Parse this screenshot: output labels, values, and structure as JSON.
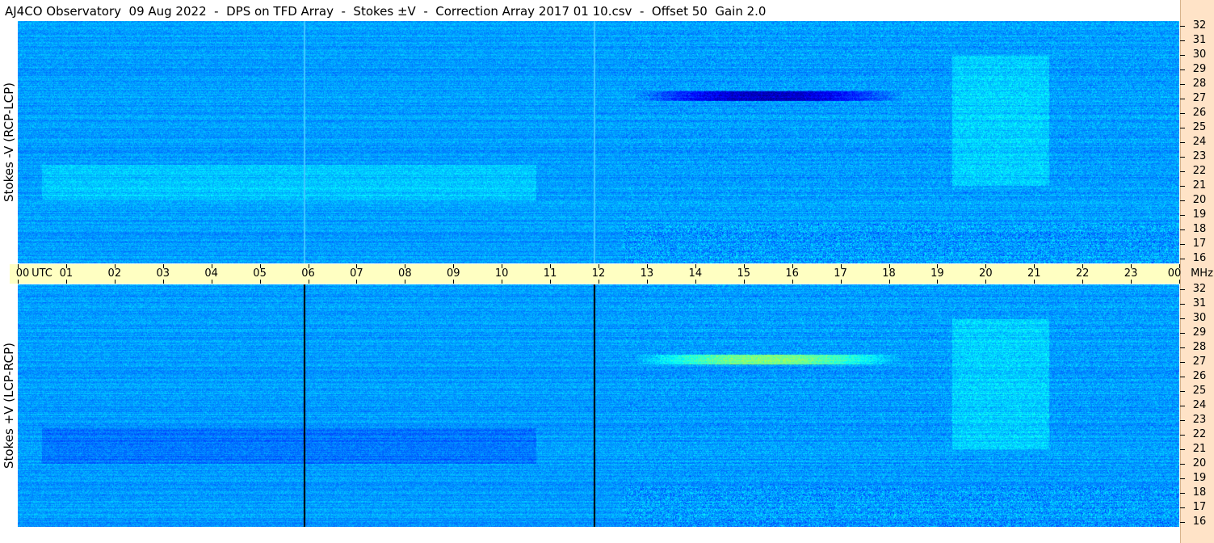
{
  "title": "AJ4CO Observatory  09 Aug 2022  -  DPS on TFD Array  -  Stokes ±V  -  Correction Array 2017 01 10.csv  -  Offset 50  Gain 2.0",
  "chart_data": {
    "type": "heatmap",
    "title": "AJ4CO Observatory  09 Aug 2022  -  DPS on TFD Array  -  Stokes ±V  -  Correction Array 2017 01 10.csv  -  Offset 50  Gain 2.0",
    "x_axis": {
      "unit_label": "UTC",
      "labels": [
        "00",
        "01",
        "02",
        "03",
        "04",
        "05",
        "06",
        "07",
        "08",
        "09",
        "10",
        "11",
        "12",
        "13",
        "14",
        "15",
        "16",
        "17",
        "18",
        "19",
        "20",
        "21",
        "22",
        "23",
        "00"
      ],
      "range_hours": [
        0,
        24
      ]
    },
    "y_axis": {
      "unit_label": "MHz",
      "labels": [
        "32",
        "31",
        "30",
        "29",
        "28",
        "27",
        "26",
        "25",
        "24",
        "23",
        "22",
        "21",
        "20",
        "19",
        "18",
        "17",
        "16"
      ],
      "range_mhz": [
        16,
        32
      ]
    },
    "panels": [
      {
        "name": "Stokes -V (RCP-LCP)",
        "colormap": "jet",
        "vertical_lines": [
          {
            "hour": 5.9,
            "color": "#40c8ff"
          },
          {
            "hour": 11.9,
            "color": "#40c8ff"
          }
        ],
        "features": [
          {
            "desc": "strong band",
            "hours": [
              12.7,
              18.3
            ],
            "mhz": 27.2,
            "level": "dark"
          },
          {
            "desc": "activity region",
            "hours": [
              12.5,
              24
            ],
            "mhz": [
              16.5,
              29
            ],
            "level": "mixed"
          }
        ]
      },
      {
        "name": "Stokes +V (LCP-RCP)",
        "colormap": "jet",
        "vertical_lines": [
          {
            "hour": 5.9,
            "color": "#000000"
          },
          {
            "hour": 11.9,
            "color": "#000000"
          }
        ],
        "features": [
          {
            "desc": "strong band",
            "hours": [
              12.7,
              18.3
            ],
            "mhz": 27.2,
            "level": "bright"
          },
          {
            "desc": "activity region",
            "hours": [
              12.5,
              24
            ],
            "mhz": [
              16.5,
              29
            ],
            "level": "mixed"
          }
        ]
      }
    ],
    "grid": false
  }
}
